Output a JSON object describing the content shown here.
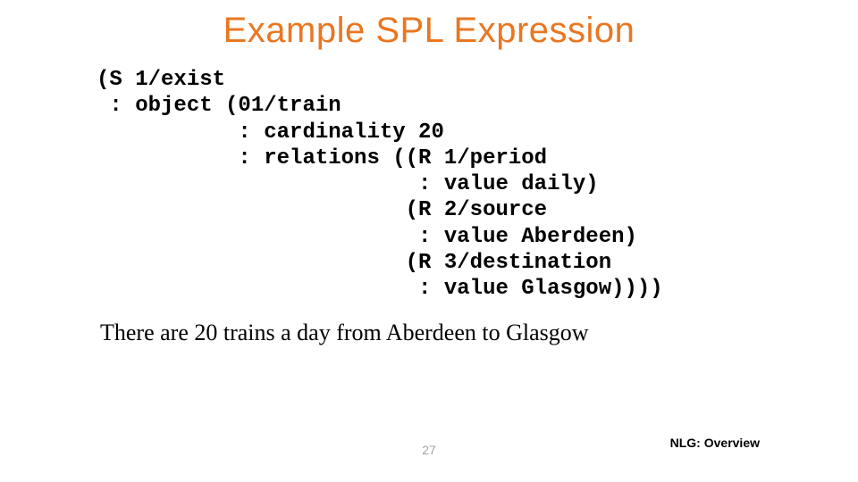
{
  "slide": {
    "title": "Example SPL Expression",
    "code": {
      "l1": "(S 1/exist",
      "l2": " : object (01/train",
      "l3": "           : cardinality 20",
      "l4": "           : relations ((R 1/period",
      "l5": "                         : value daily)",
      "l6": "                        (R 2/source",
      "l7": "                         : value Aberdeen)",
      "l8": "                        (R 3/destination",
      "l9": "                         : value Glasgow))))"
    },
    "caption": "There are 20 trains a day from Aberdeen to Glasgow",
    "page_number": "27",
    "footer": "NLG: Overview"
  }
}
